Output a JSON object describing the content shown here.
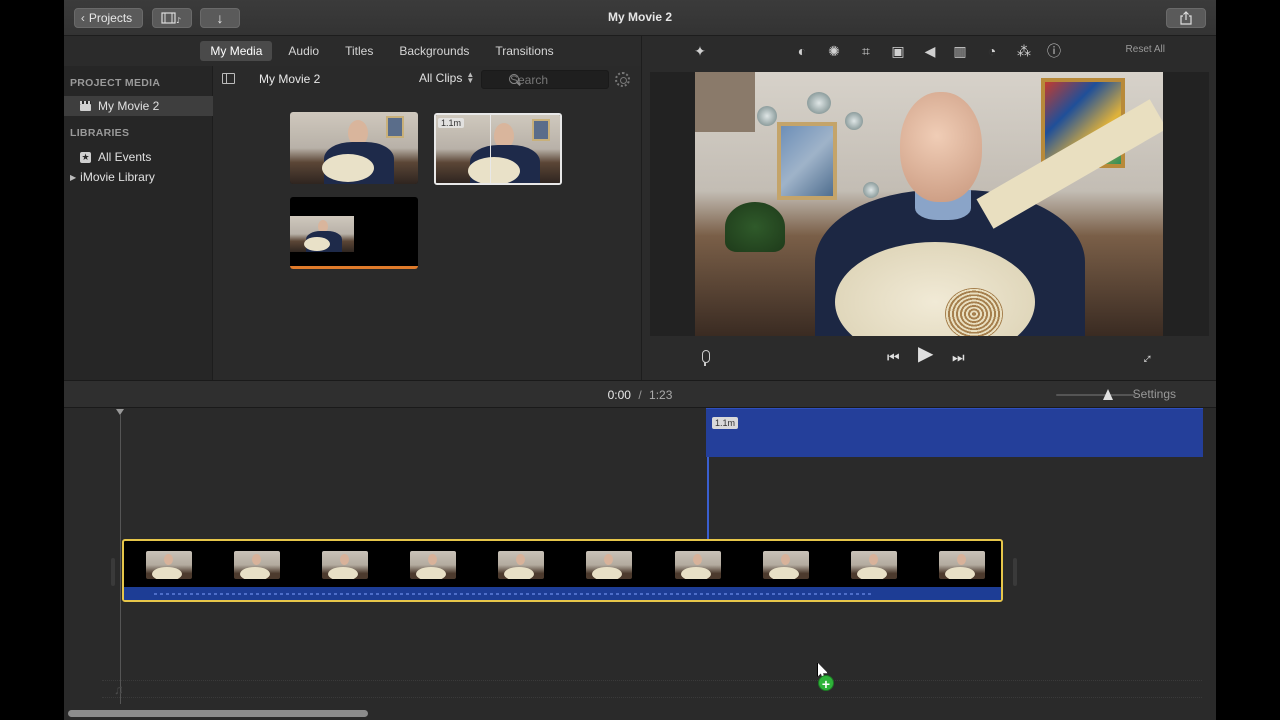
{
  "window": {
    "title": "My Movie 2"
  },
  "toolbar": {
    "projects_label": "Projects"
  },
  "browser_tabs": [
    {
      "label": "My Media",
      "active": true
    },
    {
      "label": "Audio",
      "active": false
    },
    {
      "label": "Titles",
      "active": false
    },
    {
      "label": "Backgrounds",
      "active": false
    },
    {
      "label": "Transitions",
      "active": false
    }
  ],
  "sidebar": {
    "project_media_header": "PROJECT MEDIA",
    "project_item": "My Movie 2",
    "libraries_header": "LIBRARIES",
    "all_events": "All Events",
    "library": "iMovie Library"
  },
  "media_browser": {
    "title": "My Movie 2",
    "filter": "All Clips",
    "search_placeholder": "Search",
    "selected_clip_duration": "1.1m"
  },
  "viewer": {
    "reset_all": "Reset All",
    "adjust_icons": [
      "magic-wand-icon",
      "color-balance-icon",
      "color-correction-icon",
      "crop-icon",
      "stabilization-icon",
      "volume-icon",
      "equalizer-icon",
      "speed-icon",
      "filter-icon",
      "info-icon"
    ]
  },
  "timeline": {
    "current_time": "0:00",
    "separator": "/",
    "total_time": "1:23",
    "settings_label": "Settings",
    "connected_clip_duration": "1.1m",
    "primary_clip_frames": 10
  },
  "colors": {
    "accent_selection": "#e6c64a",
    "connected_clip": "#243f9a",
    "audio_waveform": "#1d3d95",
    "add_badge": "#2fb33a",
    "import_bar": "#e07b2b"
  }
}
